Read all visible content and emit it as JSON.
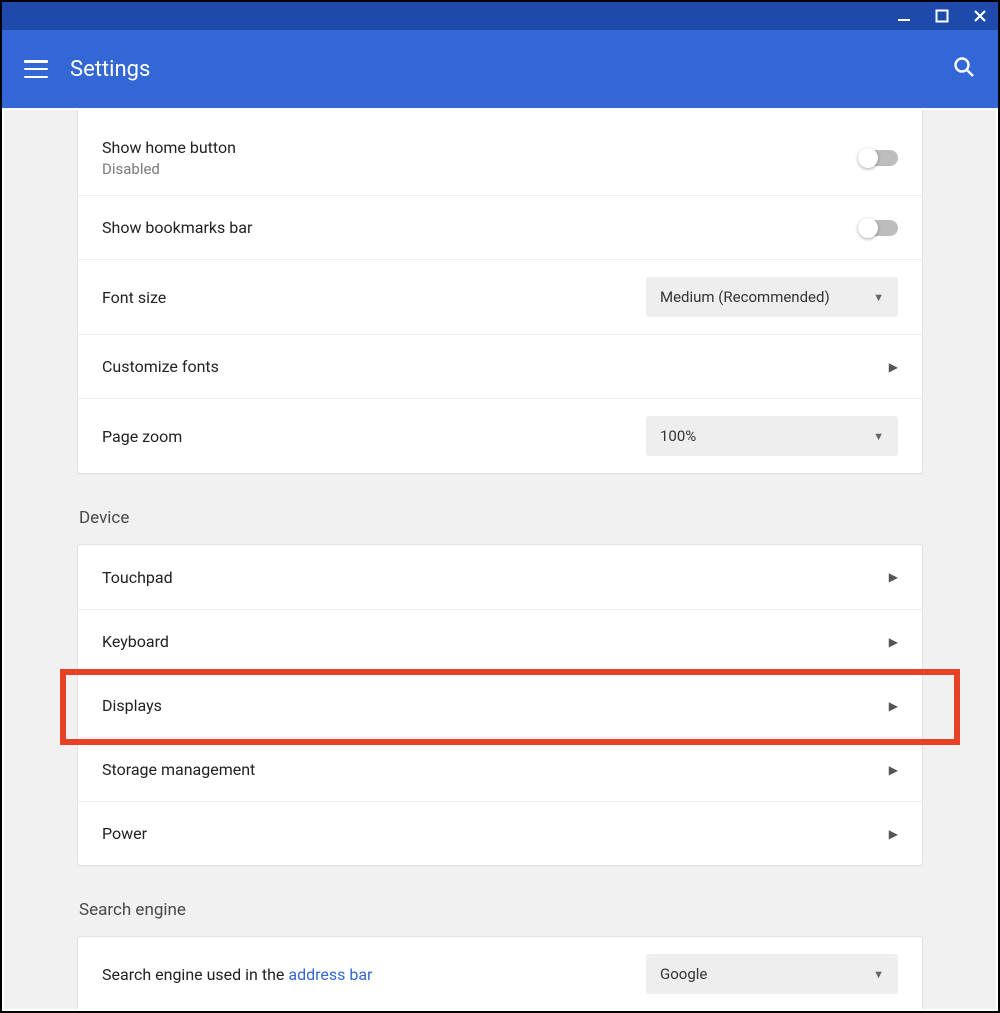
{
  "colors": {
    "accent": "#3367d6",
    "titlebar": "#1e4aab",
    "highlight": "#e74225"
  },
  "header": {
    "title": "Settings"
  },
  "appearance": {
    "home_button": {
      "label": "Show home button",
      "status": "Disabled"
    },
    "bookmarks": {
      "label": "Show bookmarks bar"
    },
    "font_size": {
      "label": "Font size",
      "value": "Medium (Recommended)"
    },
    "customize_fonts": {
      "label": "Customize fonts"
    },
    "page_zoom": {
      "label": "Page zoom",
      "value": "100%"
    }
  },
  "device": {
    "title": "Device",
    "items": [
      {
        "label": "Touchpad"
      },
      {
        "label": "Keyboard"
      },
      {
        "label": "Displays"
      },
      {
        "label": "Storage management"
      },
      {
        "label": "Power"
      }
    ]
  },
  "search_engine": {
    "title": "Search engine",
    "row_prefix": "Search engine used in the ",
    "row_link": "address bar",
    "value": "Google"
  }
}
